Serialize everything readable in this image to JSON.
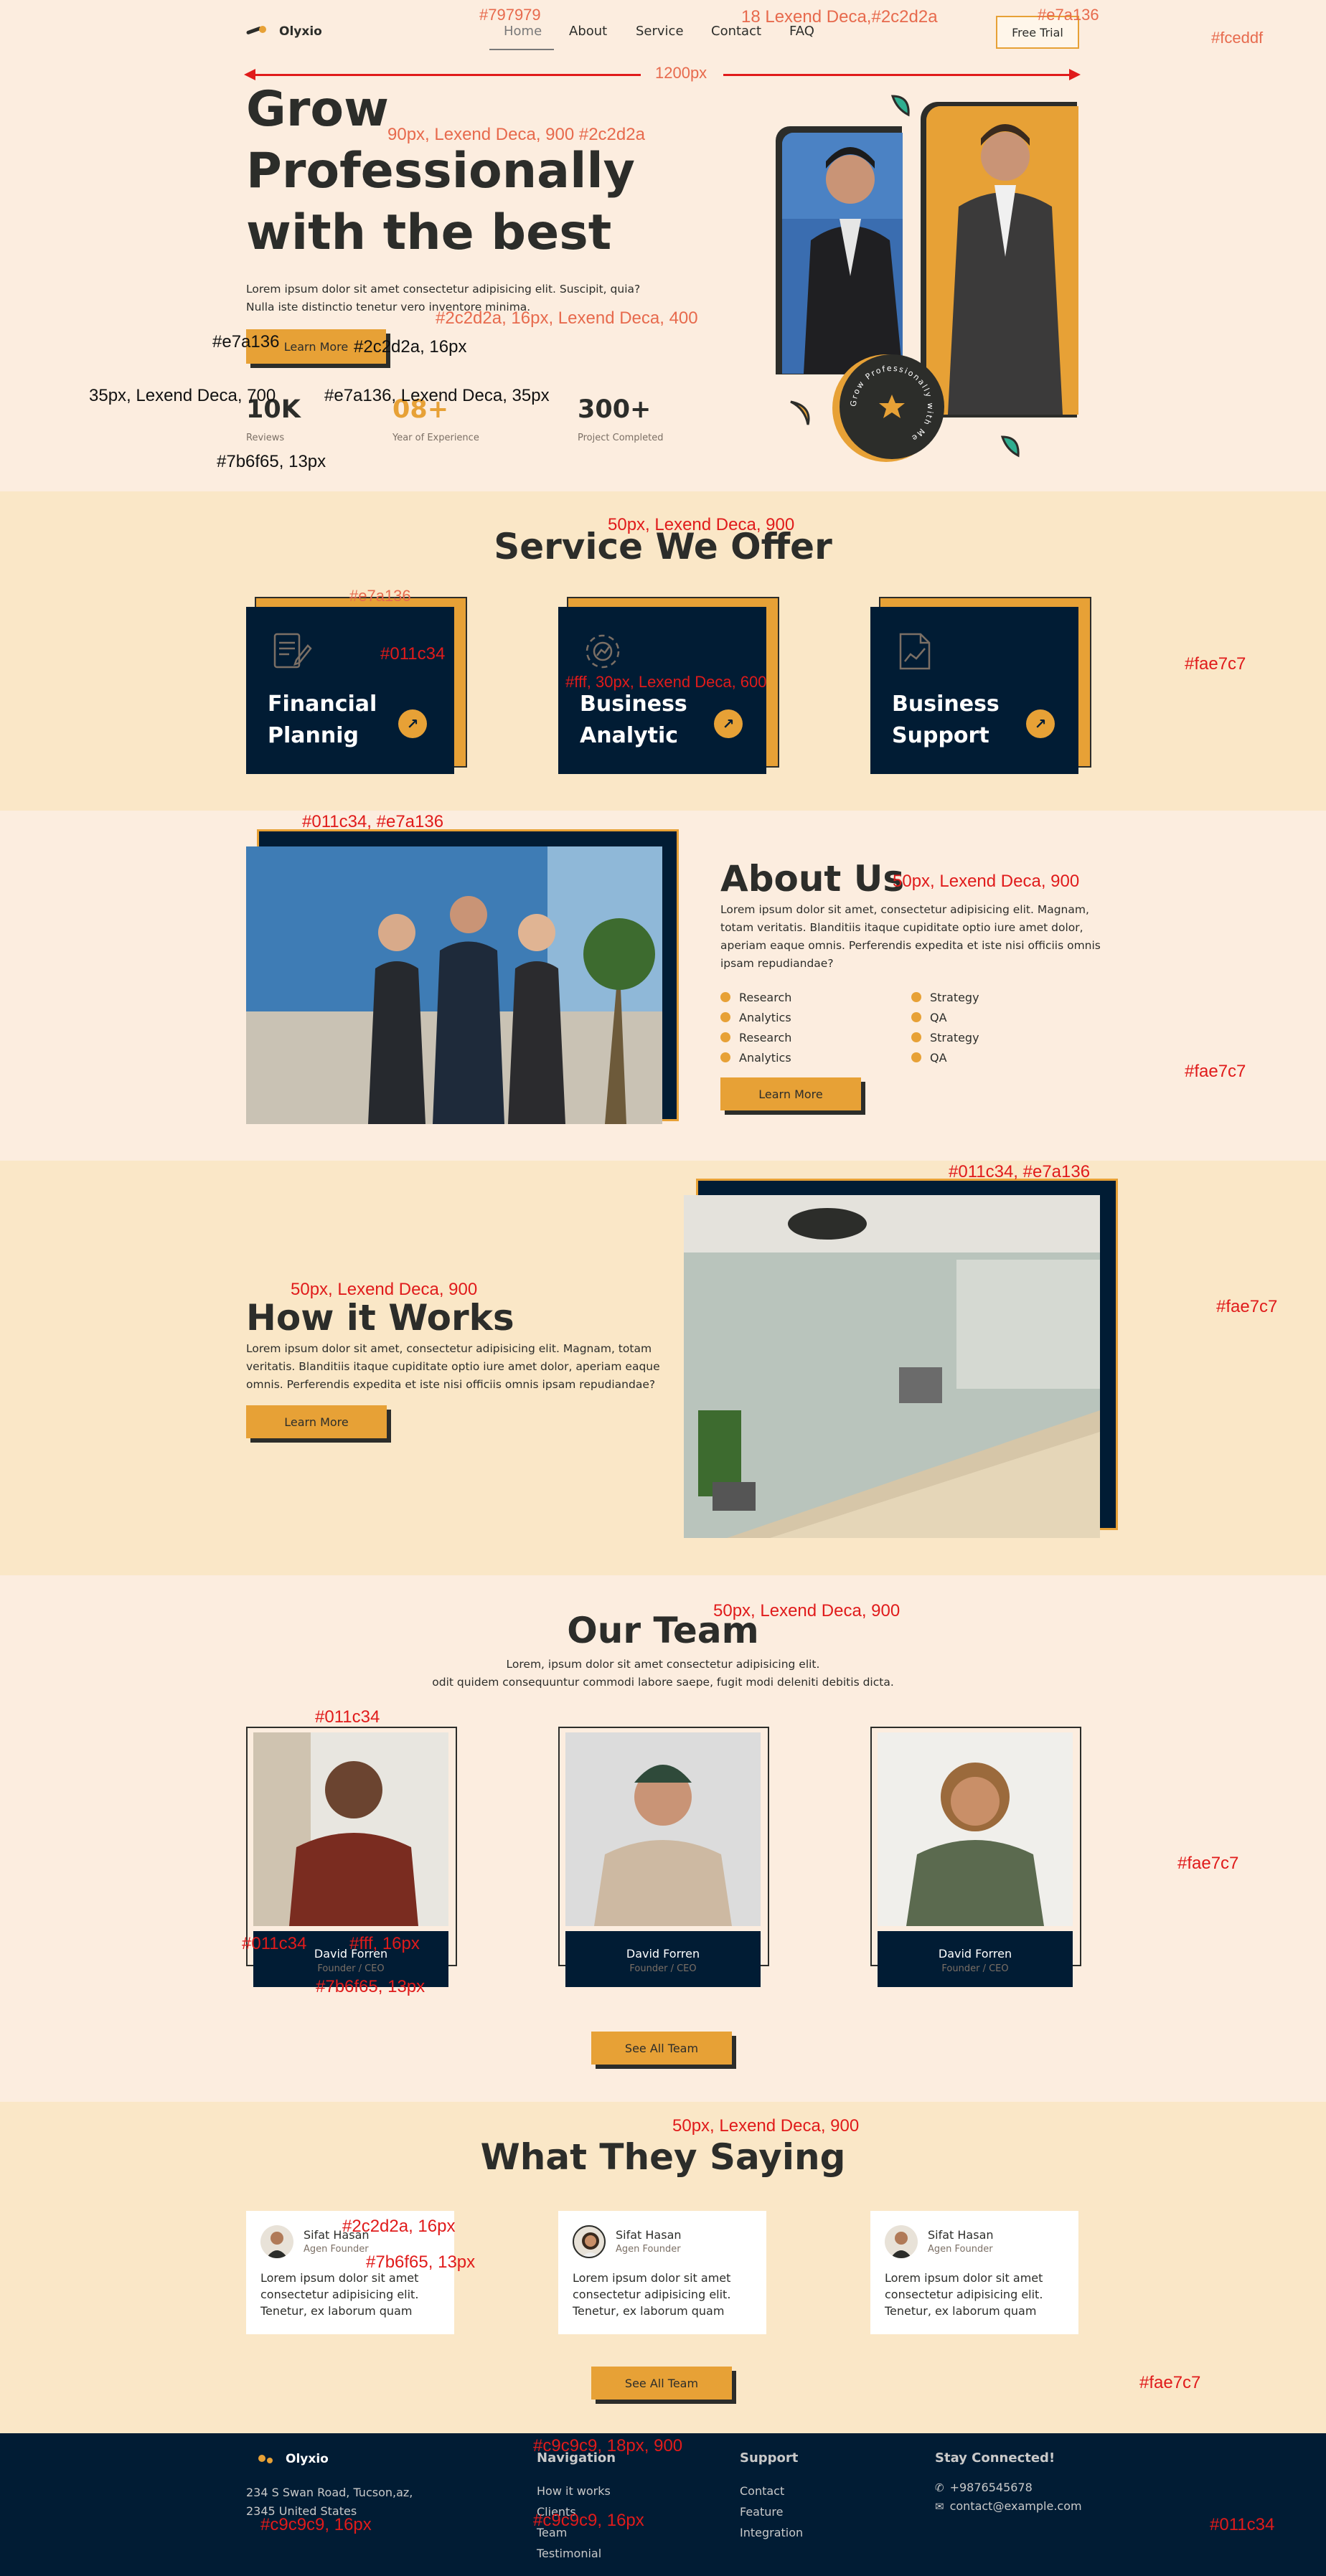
{
  "nav": {
    "brand": "Olyxio",
    "items": [
      "Home",
      "About",
      "Service",
      "Contact",
      "FAQ"
    ],
    "cta": "Free Trial",
    "width_label": "1200px"
  },
  "hero": {
    "title_lines": [
      "Grow",
      "Professionally",
      "with the best"
    ],
    "desc_lines": [
      "Lorem ipsum dolor sit amet consectetur adipisicing elit. Suscipit, quia?",
      "Nulla iste distinctio tenetur vero inventore minima."
    ],
    "button": "Learn More",
    "stats": [
      {
        "value": "10K",
        "label": "Reviews"
      },
      {
        "value": "08+",
        "label": "Year of Experience"
      },
      {
        "value": "300+",
        "label": "Project Completed"
      }
    ],
    "badge_text": "Grow Professionally with Me"
  },
  "services": {
    "title": "Service We Offer",
    "cards": [
      {
        "line1": "Financial",
        "line2": "Plannig",
        "icon": "document-pen-icon"
      },
      {
        "line1": "Business",
        "line2": "Analytic",
        "icon": "gear-analytics-icon"
      },
      {
        "line1": "Business",
        "line2": "Support",
        "icon": "chart-document-icon"
      }
    ]
  },
  "about": {
    "title": "About Us",
    "desc_lines": [
      "Lorem ipsum dolor sit amet, consectetur adipisicing elit. Magnam,",
      "totam veritatis. Blanditiis itaque cupiditate optio iure amet dolor,",
      "aperiam eaque omnis. Perferendis expedita et iste nisi officiis omnis",
      "ipsam repudiandae?"
    ],
    "bullets_left": [
      "Research",
      "Analytics",
      "Research",
      "Analytics"
    ],
    "bullets_right": [
      "Strategy",
      "QA",
      "Strategy",
      "QA"
    ],
    "button": "Learn More"
  },
  "how": {
    "title": "How it Works",
    "desc_lines": [
      "Lorem ipsum dolor sit amet, consectetur adipisicing elit. Magnam, totam",
      "veritatis. Blanditiis itaque cupiditate optio iure amet dolor, aperiam eaque",
      "omnis. Perferendis expedita et iste nisi officiis omnis ipsam repudiandae?"
    ],
    "button": "Learn More"
  },
  "team": {
    "title": "Our Team",
    "desc_lines": [
      "Lorem, ipsum dolor sit amet consectetur adipisicing elit.",
      "odit quidem consequuntur commodi labore saepe, fugit modi deleniti debitis dicta."
    ],
    "members": [
      {
        "name": "David Forren",
        "role": "Founder / CEO"
      },
      {
        "name": "David Forren",
        "role": "Founder / CEO"
      },
      {
        "name": "David Forren",
        "role": "Founder / CEO"
      }
    ],
    "button": "See All Team"
  },
  "testimonials": {
    "title": "What They Saying",
    "items": [
      {
        "name": "Sifat Hasan",
        "role": "Agen Founder",
        "lines": [
          "Lorem ipsum dolor sit amet",
          "consectetur adipisicing elit.",
          "Tenetur, ex laborum quam"
        ]
      },
      {
        "name": "Sifat Hasan",
        "role": "Agen Founder",
        "lines": [
          "Lorem ipsum dolor sit amet",
          "consectetur adipisicing elit.",
          "Tenetur, ex laborum quam"
        ]
      },
      {
        "name": "Sifat Hasan",
        "role": "Agen Founder",
        "lines": [
          "Lorem ipsum dolor sit amet",
          "consectetur adipisicing elit.",
          "Tenetur, ex laborum quam"
        ]
      }
    ],
    "button": "See All Team"
  },
  "footer": {
    "brand": "Olyxio",
    "address_lines": [
      "234 S Swan Road, Tucson,az,",
      "2345 United States"
    ],
    "navigation_title": "Navigation",
    "navigation": [
      "How it works",
      "Clients",
      "Team",
      "Testimonial"
    ],
    "support_title": "Support",
    "support": [
      "Contact",
      "Feature",
      "Integration"
    ],
    "connect_title": "Stay Connected!",
    "phone": "+9876545678",
    "email": "contact@example.com"
  },
  "annotations": {
    "a1": "#797979",
    "a2": "18 Lexend Deca,#2c2d2a",
    "a3": "#e7a136",
    "a4": "#fceddf",
    "a5": "90px, Lexend Deca, 900 #2c2d2a",
    "a6": "#2c2d2a, 16px, Lexend Deca, 400",
    "a7": "#e7a136",
    "a8": "#2c2d2a, 16px",
    "a9": "35px, Lexend Deca, 700",
    "a10": "#e7a136,  Lexend Deca, 35px",
    "a11": "#7b6f65, 13px",
    "a12": "50px, Lexend Deca, 900",
    "a13": "#e7a136",
    "a14": "#011c34",
    "a15": "#fff, 30px, Lexend Deca, 600",
    "a16": "#fae7c7",
    "a17": "#011c34, #e7a136",
    "a18": "50px, Lexend Deca, 900",
    "a19": "#fae7c7",
    "a20": "#011c34, #e7a136",
    "a21": "#fae7c7",
    "a22": "50px, Lexend Deca, 900",
    "a23": "50px, Lexend Deca, 900",
    "a24": "#011c34",
    "a25": "#fae7c7",
    "a26": "#011c34",
    "a27": "#fff, 16px",
    "a28": "#7b6f65, 13px",
    "a29": "50px, Lexend Deca, 900",
    "a30": "#2c2d2a, 16px",
    "a31": "#7b6f65, 13px",
    "a32": "#fae7c7",
    "a33": "#c9c9c9, 18px, 900",
    "a34": "#c9c9c9, 16px",
    "a35": "#c9c9c9, 16px",
    "a36": "#011c34"
  },
  "colors": {
    "page_bg": "#fceddf",
    "section_bg": "#fae7c7",
    "accent": "#e7a136",
    "navy": "#011c34",
    "text": "#2c2d2a",
    "muted": "#7b6f65",
    "footer_text": "#c9c9c9"
  }
}
